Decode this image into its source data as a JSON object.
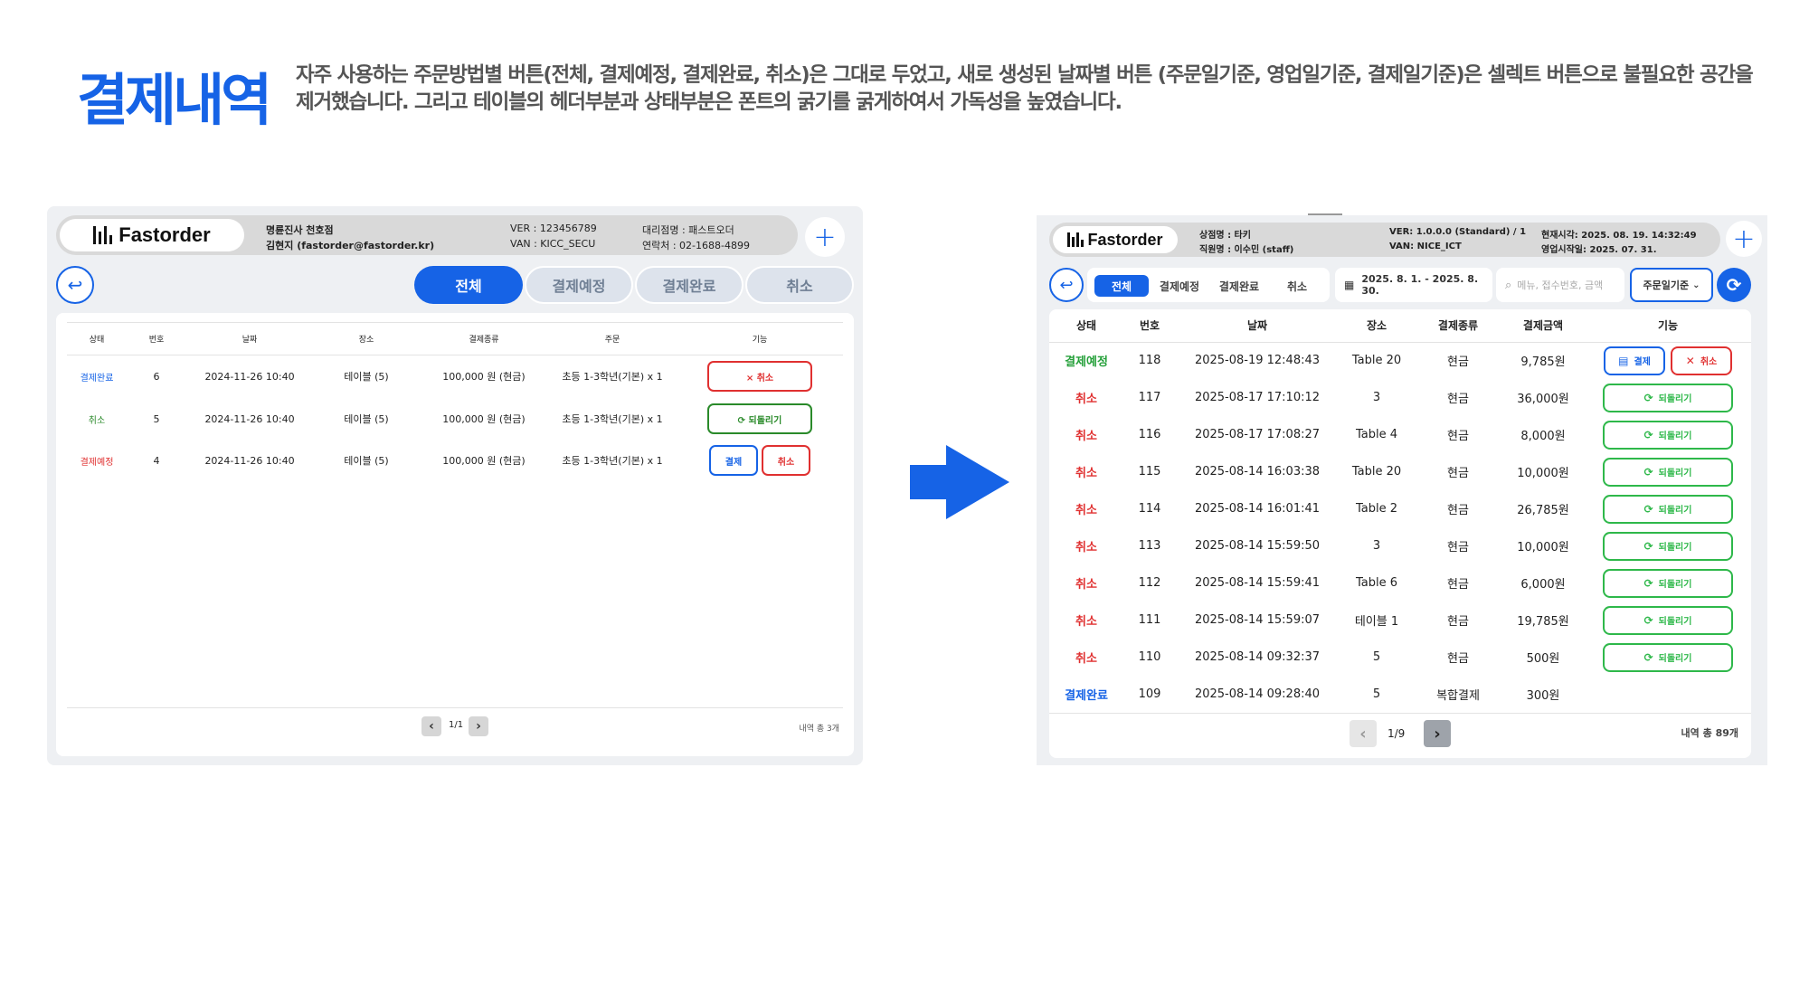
{
  "heading": {
    "title": "결제내역",
    "description": "자주 사용하는 주문방법별 버튼(전체, 결제예정, 결제완료, 취소)은 그대로 두었고, 새로 생성된 날짜별 버튼 (주문일기준, 영업일기준, 결제일기준)은 셀렉트 버튼으로 불필요한 공간을 제거했습니다. 그리고 테이블의 헤더부분과 상태부분은 폰트의 굵기를 굵게하여서 가독성을 높였습니다."
  },
  "colors": {
    "accent": "#1663e6",
    "cancel": "#e03030",
    "restore": "#2a8a2a",
    "panel_bg": "#eef0f3"
  },
  "before": {
    "logo": "Fastorder",
    "header": {
      "store": "명륜진사 천호점",
      "user": "김현지 (fastorder@fastorder.kr)",
      "ver": "VER : 123456789",
      "van": "VAN : KICC_SECU",
      "agency": "대리점명 : 패스트오더",
      "contact": "연락처 : 02-1688-4899"
    },
    "plus_icon": "plus-icon",
    "back_icon": "back-arrow-icon",
    "tabs": [
      "전체",
      "결제예정",
      "결제완료",
      "취소"
    ],
    "columns": [
      "상태",
      "번호",
      "날짜",
      "장소",
      "결제종류",
      "주문",
      "기능"
    ],
    "rows": [
      {
        "status": "결제완료",
        "status_color": "blue",
        "no": "6",
        "date": "2024-11-26  10:40",
        "place": "테이블 (5)",
        "payment": "100,000 원 (현금)",
        "order": "초등 1-3학년(기본) x 1",
        "actions": [
          {
            "label": "× 취소",
            "style": "red",
            "wide": true
          }
        ]
      },
      {
        "status": "취소",
        "status_color": "green",
        "no": "5",
        "date": "2024-11-26  10:40",
        "place": "테이블 (5)",
        "payment": "100,000 원 (현금)",
        "order": "초등 1-3학년(기본) x 1",
        "actions": [
          {
            "label": "⟳ 되돌리기",
            "style": "green",
            "wide": true
          }
        ]
      },
      {
        "status": "결제예정",
        "status_color": "red",
        "no": "4",
        "date": "2024-11-26  10:40",
        "place": "테이블 (5)",
        "payment": "100,000 원 (현금)",
        "order": "초등 1-3학년(기본) x 1",
        "actions": [
          {
            "label": "결제",
            "style": "blue",
            "wide": false
          },
          {
            "label": "취소",
            "style": "red",
            "wide": false
          }
        ]
      }
    ],
    "pager": {
      "text": "1/1",
      "prev": "‹",
      "next": "›"
    },
    "total": "내역 총 3개"
  },
  "arrow_icon": "right-arrow-icon",
  "after": {
    "logo": "Fastorder",
    "header": {
      "store": "상점명 : 타키",
      "staff": "직원명 : 이수민 (staff)",
      "ver": "VER: 1.0.0.0  (Standard) / 1",
      "van": "VAN: NICE_ICT",
      "now": "현재시각: 2025. 08. 19. 14:32:49",
      "open": "영업시작일: 2025. 07. 31."
    },
    "tabs": [
      "전체",
      "결제예정",
      "결제완료",
      "취소"
    ],
    "date_range": "2025. 8. 1. - 2025. 8. 30.",
    "search_placeholder": "메뉴, 접수번호, 금액",
    "select_value": "주문일기준",
    "columns": [
      "상태",
      "번호",
      "날짜",
      "장소",
      "결제종류",
      "결제금액",
      "기능"
    ],
    "rows": [
      {
        "status": "결제예정",
        "status_color": "green",
        "no": "118",
        "date": "2025-08-19 12:48:43",
        "place": "Table 20",
        "type": "현금",
        "amount": "9,785원",
        "actions": [
          "결제",
          "취소"
        ]
      },
      {
        "status": "취소",
        "status_color": "red",
        "no": "117",
        "date": "2025-08-17 17:10:12",
        "place": "3",
        "type": "현금",
        "amount": "36,000원",
        "actions": [
          "되돌리기"
        ]
      },
      {
        "status": "취소",
        "status_color": "red",
        "no": "116",
        "date": "2025-08-17 17:08:27",
        "place": "Table 4",
        "type": "현금",
        "amount": "8,000원",
        "actions": [
          "되돌리기"
        ]
      },
      {
        "status": "취소",
        "status_color": "red",
        "no": "115",
        "date": "2025-08-14 16:03:38",
        "place": "Table 20",
        "type": "현금",
        "amount": "10,000원",
        "actions": [
          "되돌리기"
        ]
      },
      {
        "status": "취소",
        "status_color": "red",
        "no": "114",
        "date": "2025-08-14 16:01:41",
        "place": "Table 2",
        "type": "현금",
        "amount": "26,785원",
        "actions": [
          "되돌리기"
        ]
      },
      {
        "status": "취소",
        "status_color": "red",
        "no": "113",
        "date": "2025-08-14 15:59:50",
        "place": "3",
        "type": "현금",
        "amount": "10,000원",
        "actions": [
          "되돌리기"
        ]
      },
      {
        "status": "취소",
        "status_color": "red",
        "no": "112",
        "date": "2025-08-14 15:59:41",
        "place": "Table 6",
        "type": "현금",
        "amount": "6,000원",
        "actions": [
          "되돌리기"
        ]
      },
      {
        "status": "취소",
        "status_color": "red",
        "no": "111",
        "date": "2025-08-14 15:59:07",
        "place": "테이블 1",
        "type": "현금",
        "amount": "19,785원",
        "actions": [
          "되돌리기"
        ]
      },
      {
        "status": "취소",
        "status_color": "red",
        "no": "110",
        "date": "2025-08-14 09:32:37",
        "place": "5",
        "type": "현금",
        "amount": "500원",
        "actions": [
          "되돌리기"
        ]
      },
      {
        "status": "결제완료",
        "status_color": "blue",
        "no": "109",
        "date": "2025-08-14 09:28:40",
        "place": "5",
        "type": "복합결제",
        "amount": "300원",
        "actions": []
      }
    ],
    "pager": {
      "text": "1/9",
      "prev": "‹",
      "next": "›"
    },
    "total": "내역 총 89개"
  }
}
